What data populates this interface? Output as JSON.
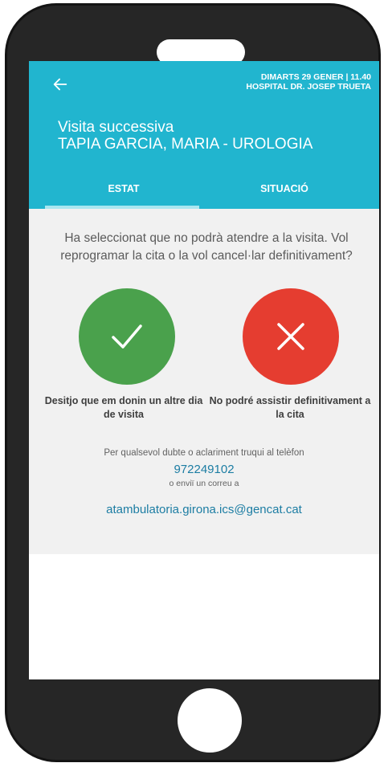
{
  "header": {
    "date_time": "DIMARTS 29 GENER | 11.40",
    "hospital": "HOSPITAL DR. JOSEP TRUETA",
    "visit_type": "Visita successiva",
    "patient_service": "TAPIA GARCIA, MARIA - UROLOGIA",
    "icons": {
      "back": "arrow-left-icon"
    }
  },
  "tabs": [
    {
      "label": "ESTAT",
      "active": true
    },
    {
      "label": "SITUACIÓ",
      "active": false
    }
  ],
  "content": {
    "question": "Ha seleccionat que no podrà atendre a la visita. Vol reprogramar la cita o la vol cancel·lar definitivament?",
    "options": [
      {
        "label": "Desitjo que em donin un altre dia de visita",
        "icon": "check-icon",
        "color": "#4aa14c"
      },
      {
        "label": "No podré assistir definitivament a la cita",
        "icon": "close-icon",
        "color": "#e53d30"
      }
    ],
    "contact": {
      "intro": "Per qualsevol dubte o aclariment truqui al telèfon",
      "phone": "972249102",
      "or_email": "o enviï un correu a",
      "email": "atambulatoria.girona.ics@gencat.cat"
    }
  },
  "colors": {
    "header": "#21b5cf",
    "content_bg": "#f1f1f1",
    "link": "#1c7da3",
    "phone_body": "#262626"
  }
}
